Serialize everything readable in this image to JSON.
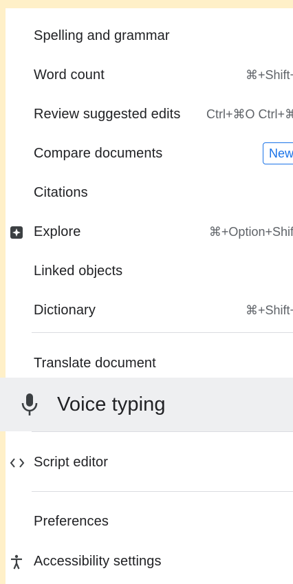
{
  "menu": {
    "items": [
      {
        "label": "Spelling and grammar",
        "shortcut": ""
      },
      {
        "label": "Word count",
        "shortcut": "⌘+Shift+"
      },
      {
        "label": "Review suggested edits",
        "shortcut": "Ctrl+⌘O Ctrl+⌘"
      },
      {
        "label": "Compare documents",
        "badge": "New"
      },
      {
        "label": "Citations"
      },
      {
        "label": "Explore",
        "shortcut": "⌘+Option+Shift",
        "icon": "explore-icon"
      },
      {
        "label": "Linked objects"
      },
      {
        "label": "Dictionary",
        "shortcut": "⌘+Shift+"
      },
      {
        "label": "Translate document"
      },
      {
        "label": "Voice typing",
        "icon": "microphone-icon",
        "highlighted": true
      },
      {
        "label": "Script editor",
        "icon": "code-brackets-icon"
      },
      {
        "label": "Preferences"
      },
      {
        "label": "Accessibility settings",
        "icon": "accessibility-icon"
      }
    ]
  },
  "colors": {
    "background": "#fff0c8",
    "menu": "#ffffff",
    "highlight": "#eeeff1",
    "badge": "#1a73e8"
  }
}
